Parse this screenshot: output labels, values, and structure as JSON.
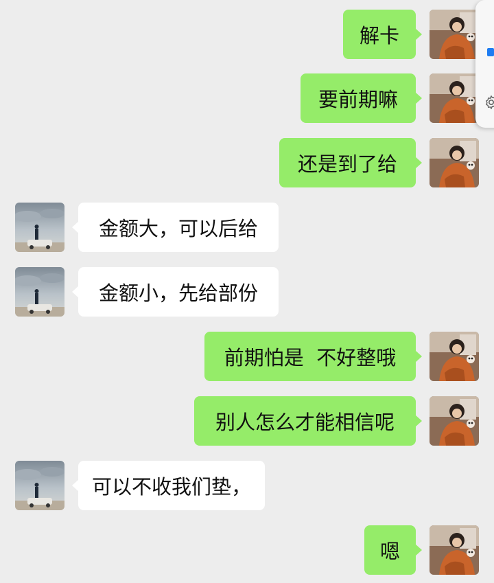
{
  "messages": [
    {
      "side": "out",
      "text": "解卡"
    },
    {
      "side": "out",
      "text": "要前期嘛"
    },
    {
      "side": "out",
      "text": "还是到了给"
    },
    {
      "side": "in",
      "text": "金额大，可以后给"
    },
    {
      "side": "in",
      "text": "金额小，先给部份"
    },
    {
      "side": "out",
      "text": "前期怕是  不好整哦"
    },
    {
      "side": "out",
      "text": "别人怎么才能相信呢"
    },
    {
      "side": "in",
      "text": "可以不收我们垫，"
    },
    {
      "side": "out",
      "text": "嗯"
    }
  ],
  "colors": {
    "background": "#ededed",
    "outgoing_bubble": "#95ec69",
    "incoming_bubble": "#ffffff",
    "text": "#111111",
    "widget_accent": "#1e7cf2"
  },
  "icons": {
    "sender_avatar": "user-avatar-icon",
    "contact_avatar": "contact-avatar-icon",
    "widget_settings": "gear-icon"
  }
}
